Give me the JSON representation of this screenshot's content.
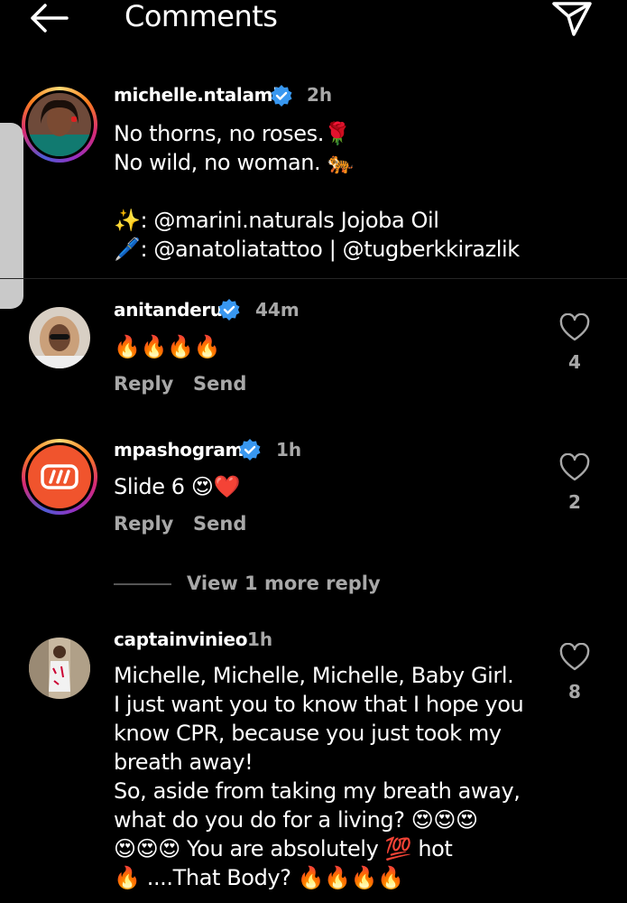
{
  "header": {
    "title": "Comments",
    "back_icon": "arrow-left-icon",
    "share_icon": "paper-plane-icon"
  },
  "colors": {
    "background": "#000000",
    "text": "#ffffff",
    "muted": "#a8a8a8",
    "verified": "#3897f0",
    "fire": "#ff7a00",
    "heart": "#e0102a"
  },
  "post": {
    "username": "michelle.ntalami",
    "verified": true,
    "time": "2h",
    "caption_line1": "No thorns, no roses.",
    "caption_line2": "No wild, no woman.",
    "caption_line4": ": @marini.naturals Jojoba Oil",
    "caption_line5": ": @anatoliatattoo | @tugberkkirazlik",
    "emoji_rose": "🌹",
    "emoji_tiger": "🐅",
    "emoji_sparkles": "✨",
    "emoji_pen": "🖊️"
  },
  "comments": [
    {
      "username": "anitanderu",
      "verified": true,
      "time": "44m",
      "text": "🔥🔥🔥🔥",
      "likes": "4",
      "reply_label": "Reply",
      "send_label": "Send"
    },
    {
      "username": "mpashogram",
      "verified": true,
      "time": "1h",
      "text": "Slide 6 😍❤️",
      "likes": "2",
      "reply_label": "Reply",
      "send_label": "Send",
      "view_more": "View 1 more reply"
    },
    {
      "username": "captainvinieo",
      "verified": false,
      "time": "1h",
      "lines": [
        "Michelle, Michelle, Michelle, Baby Girl.",
        "I just want you to know that I hope you",
        "know CPR, because you just took my",
        "breath away!",
        "So, aside from taking my breath away,",
        "what do you do for a living? 😍😍😍",
        "😍😍😍 You are absolutely 💯 hot",
        "🔥 ....That Body? 🔥🔥🔥🔥"
      ],
      "likes": "8"
    }
  ]
}
